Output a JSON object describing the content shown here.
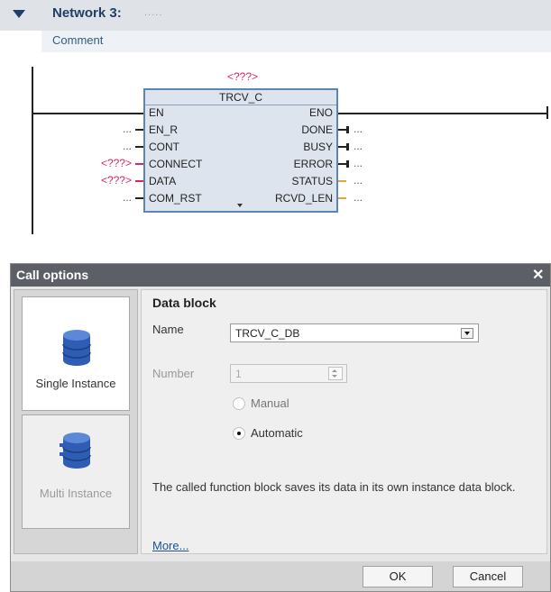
{
  "network": {
    "title": "Network 3:",
    "title_dots": ".....",
    "comment": "Comment"
  },
  "block": {
    "instance_label": "<???>",
    "name": "TRCV_C",
    "inputs": [
      "EN",
      "EN_R",
      "CONT",
      "CONNECT",
      "DATA",
      "COM_RST"
    ],
    "outputs": [
      "ENO",
      "DONE",
      "BUSY",
      "ERROR",
      "STATUS",
      "RCVD_LEN"
    ],
    "input_params": [
      "",
      "...",
      "...",
      "<???>",
      "<???>",
      "..."
    ],
    "output_params": [
      "",
      "...",
      "...",
      "...",
      "...",
      "..."
    ]
  },
  "dialog": {
    "title": "Call options",
    "close": "✕",
    "tiles": [
      {
        "label": "Single Instance",
        "icon": "database-icon"
      },
      {
        "label": "Multi Instance",
        "icon": "database-icon"
      }
    ],
    "section_title": "Data block",
    "name_label": "Name",
    "name_value": "TRCV_C_DB",
    "number_label": "Number",
    "number_value": "1",
    "radio_manual": "Manual",
    "radio_automatic": "Automatic",
    "description": "The called function block saves its data in its own instance data block.",
    "more_link": "More...",
    "ok": "OK",
    "cancel": "Cancel"
  },
  "colors": {
    "accent_blue": "#1f3f66",
    "fb_border": "#5a85b5",
    "unassigned_red": "#e0245e",
    "title_bar": "#5c6066",
    "database_blue": "#2f5db3"
  }
}
